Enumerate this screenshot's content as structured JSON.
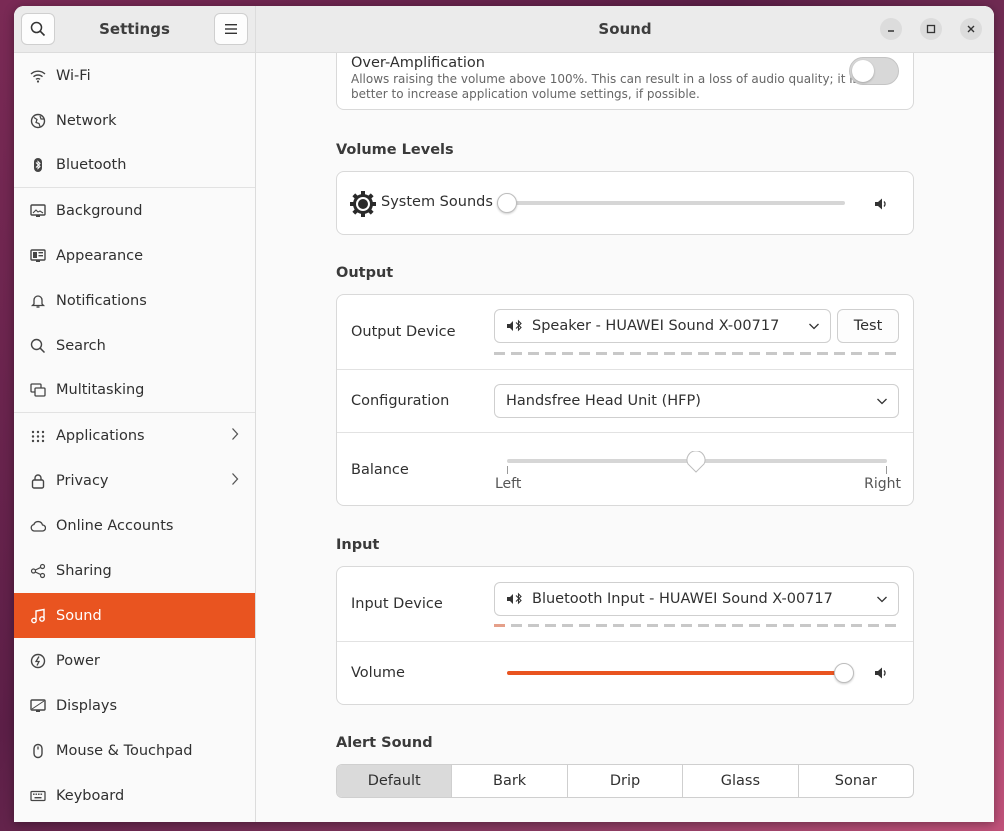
{
  "sidebar": {
    "title": "Settings",
    "items": [
      {
        "label": "Wi-Fi",
        "icon": "wifi-icon"
      },
      {
        "label": "Network",
        "icon": "network-icon"
      },
      {
        "label": "Bluetooth",
        "icon": "bluetooth-icon"
      },
      {
        "label": "Background",
        "icon": "background-icon"
      },
      {
        "label": "Appearance",
        "icon": "appearance-icon"
      },
      {
        "label": "Notifications",
        "icon": "bell-icon"
      },
      {
        "label": "Search",
        "icon": "search-icon"
      },
      {
        "label": "Multitasking",
        "icon": "multitasking-icon"
      },
      {
        "label": "Applications",
        "icon": "grid-icon"
      },
      {
        "label": "Privacy",
        "icon": "lock-icon"
      },
      {
        "label": "Online Accounts",
        "icon": "cloud-icon"
      },
      {
        "label": "Sharing",
        "icon": "share-icon"
      },
      {
        "label": "Sound",
        "icon": "music-note-icon"
      },
      {
        "label": "Power",
        "icon": "power-icon"
      },
      {
        "label": "Displays",
        "icon": "display-icon"
      },
      {
        "label": "Mouse & Touchpad",
        "icon": "mouse-icon"
      },
      {
        "label": "Keyboard",
        "icon": "keyboard-icon"
      }
    ],
    "active": "Sound"
  },
  "header": {
    "title": "Sound"
  },
  "over_amplification": {
    "title": "Over-Amplification",
    "description_line1": "Allows raising the volume above 100%. This can result in a loss of audio quality; it is",
    "description_line2": "better to increase application volume settings, if possible.",
    "enabled": false
  },
  "volume_levels": {
    "title": "Volume Levels",
    "system_sounds_label": "System Sounds",
    "system_sounds_level": 0
  },
  "output": {
    "title": "Output",
    "device_label": "Output Device",
    "device_value": "Speaker - HUAWEI Sound X-00717",
    "test_label": "Test",
    "configuration_label": "Configuration",
    "configuration_value": "Handsfree Head Unit (HFP)",
    "balance_label": "Balance",
    "balance_left": "Left",
    "balance_right": "Right",
    "balance_value": 0.5
  },
  "input": {
    "title": "Input",
    "device_label": "Input Device",
    "device_value": "Bluetooth Input - HUAWEI Sound X-00717",
    "volume_label": "Volume",
    "volume_level": 1.0
  },
  "alert_sound": {
    "title": "Alert Sound",
    "options": [
      "Default",
      "Bark",
      "Drip",
      "Glass",
      "Sonar"
    ],
    "selected": "Default"
  },
  "colors": {
    "accent": "#e95420"
  }
}
